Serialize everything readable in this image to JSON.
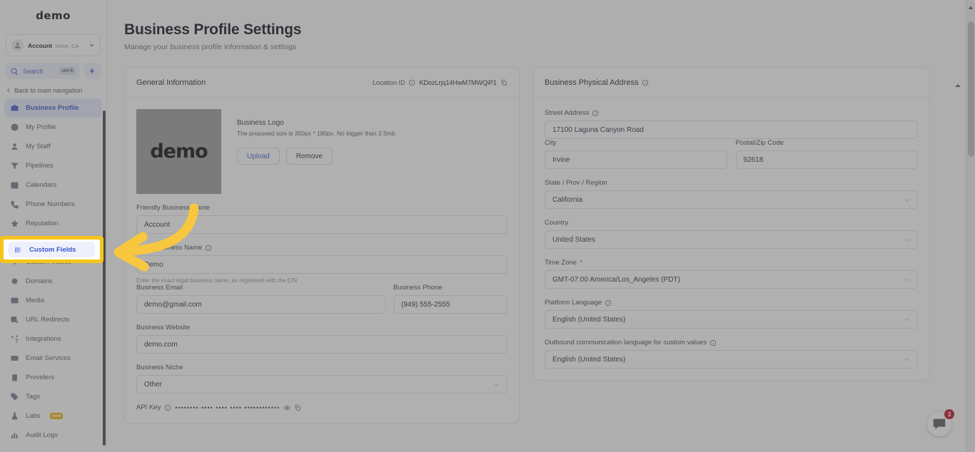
{
  "sidebar": {
    "brand": "demo",
    "account": {
      "name": "Account",
      "location": "Irvine, CA"
    },
    "search": {
      "label": "Search",
      "shortcut": "ctrl K"
    },
    "back_nav": "Back to main navigation",
    "items": [
      {
        "label": "Business Profile",
        "icon": "briefcase-icon",
        "active": true
      },
      {
        "label": "My Profile",
        "icon": "user-circle-icon"
      },
      {
        "label": "My Staff",
        "icon": "user-icon"
      },
      {
        "label": "Pipelines",
        "icon": "funnel-icon"
      },
      {
        "label": "Calendars",
        "icon": "calendar-icon"
      },
      {
        "label": "Phone Numbers",
        "icon": "phone-icon"
      },
      {
        "label": "Reputation",
        "icon": "star-icon"
      },
      {
        "label": "Custom Fields",
        "icon": "columns-icon",
        "highlighted": true
      },
      {
        "label": "Custom Values",
        "icon": "diamond-icon"
      },
      {
        "label": "Domains",
        "icon": "globe-icon"
      },
      {
        "label": "Media",
        "icon": "image-icon"
      },
      {
        "label": "URL Redirects",
        "icon": "redirect-icon"
      },
      {
        "label": "Integrations",
        "icon": "nodes-icon"
      },
      {
        "label": "Email Services",
        "icon": "envelope-icon"
      },
      {
        "label": "Providers",
        "icon": "clipboard-icon"
      },
      {
        "label": "Tags",
        "icon": "tag-icon"
      },
      {
        "label": "Labs",
        "icon": "flask-icon",
        "badge": "new"
      },
      {
        "label": "Audit Logs",
        "icon": "bars-icon"
      }
    ]
  },
  "page": {
    "title": "Business Profile Settings",
    "subtitle": "Manage your business profile information & settings"
  },
  "general": {
    "card_title": "General Information",
    "location_id_label": "Location ID",
    "location_id_value": "KDozLrjq14HwM7MWQiP1",
    "logo": {
      "image_text": "demo",
      "title": "Business Logo",
      "description": "The proposed size is 350px * 180px. No bigger than 2.5mb",
      "upload_label": "Upload",
      "remove_label": "Remove"
    },
    "fields": {
      "friendly_name_label": "Friendly Business Name",
      "friendly_name_value": "Account",
      "legal_name_label": "Legal Business Name",
      "legal_name_value": "Demo",
      "legal_name_hint": "Enter the exact legal business name, as registered with the EIN",
      "email_label": "Business Email",
      "email_value": "demo@gmail.com",
      "phone_label": "Business Phone",
      "phone_value": "(949) 555-2555",
      "website_label": "Business Website",
      "website_value": "demo.com",
      "niche_label": "Business Niche",
      "niche_value": "Other",
      "api_key_label": "API Key",
      "api_key_value": "•••••••• •••• •••• •••• ••••••••••••"
    }
  },
  "address": {
    "card_title": "Business Physical Address",
    "street_label": "Street Address",
    "street_value": "17100 Laguna Canyon Road",
    "city_label": "City",
    "city_value": "Irvine",
    "zip_label": "Postal/Zip Code",
    "zip_value": "92618",
    "state_label": "State / Prov / Region",
    "state_value": "California",
    "country_label": "Country",
    "country_value": "United States",
    "timezone_label": "Time Zone",
    "timezone_required": "*",
    "timezone_value": "GMT-07:00 America/Los_Angeles (PDT)",
    "platform_language_label": "Platform Language",
    "platform_language_value": "English (United States)",
    "outbound_language_label": "Outbound communication language for custom values",
    "outbound_language_value": "English (United States)"
  },
  "chat": {
    "unread_count": "3"
  },
  "colors": {
    "accent": "#4b61d1",
    "highlight": "#f5c518",
    "badge": "#c0172a",
    "new_badge": "#f3b70c"
  }
}
